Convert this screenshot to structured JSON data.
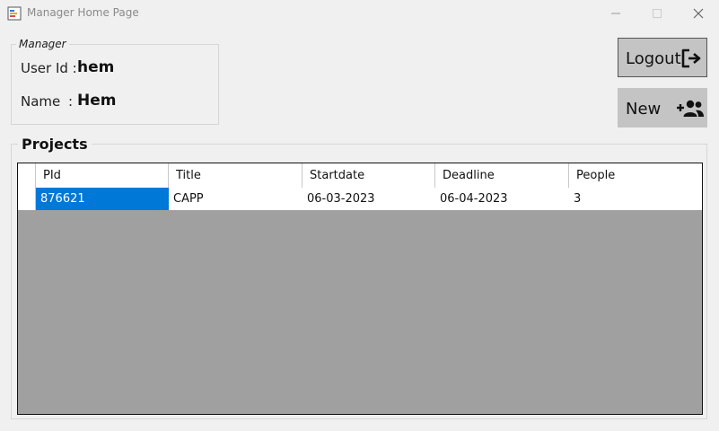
{
  "window": {
    "title": "Manager Home Page",
    "controls": {
      "minimize": "minimize-icon",
      "maximize": "maximize-icon",
      "close": "close-icon"
    }
  },
  "manager": {
    "group_label": "Manager",
    "user_id_label": "User Id :",
    "user_id_value": "hem",
    "name_label": "Name",
    "name_colon": ":",
    "name_value": "Hem"
  },
  "buttons": {
    "logout_label": "Logout",
    "logout_icon": "logout-icon",
    "new_label": "New",
    "new_icon": "add-users-icon"
  },
  "projects": {
    "group_label": "Projects",
    "columns": [
      "PId",
      "Title",
      "Startdate",
      "Deadline",
      "People"
    ],
    "rows": [
      [
        "876621",
        "CAPP",
        "06-03-2023",
        "06-04-2023",
        "3"
      ]
    ],
    "selection_color": "#0078d7"
  }
}
